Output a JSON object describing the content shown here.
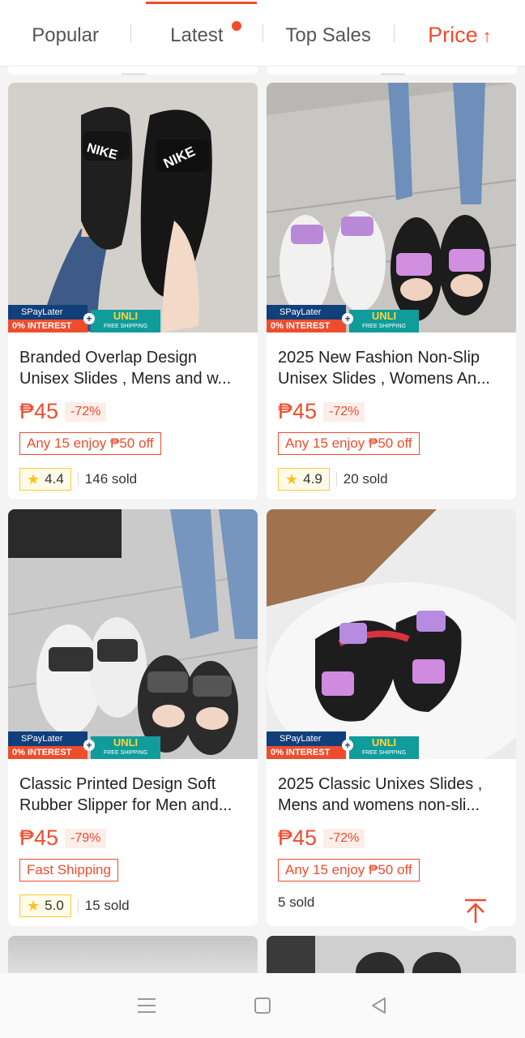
{
  "sort_tabs": [
    {
      "label": "Popular"
    },
    {
      "label": "Latest"
    },
    {
      "label": "Top Sales"
    },
    {
      "label": "Price",
      "arrow": "↑"
    }
  ],
  "badge": {
    "spay": "SPayLater",
    "interest": "0% INTEREST",
    "unli": "UNLI",
    "shipping": "FREE SHIPPING"
  },
  "products": [
    {
      "title_line1": "Branded Overlap Design",
      "title_line2": "Unisex Slides , Mens and w...",
      "price": "₱45",
      "discount": "-72%",
      "promo": "Any 15 enjoy ₱50 off",
      "rating": "4.4",
      "sold": "146 sold"
    },
    {
      "title_line1": "2025 New Fashion Non-Slip",
      "title_line2": "Unisex Slides , Womens An...",
      "price": "₱45",
      "discount": "-72%",
      "promo": "Any 15 enjoy ₱50 off",
      "rating": "4.9",
      "sold": "20 sold"
    },
    {
      "title_line1": "Classic Printed Design Soft",
      "title_line2": "Rubber Slipper for Men and...",
      "price": "₱45",
      "discount": "-79%",
      "promo": "Fast Shipping",
      "rating": "5.0",
      "sold": "15 sold"
    },
    {
      "title_line1": "2025 Classic Unixes Slides ,",
      "title_line2": "Mens and womens non-sli...",
      "price": "₱45",
      "discount": "-72%",
      "promo": "Any 15 enjoy ₱50 off",
      "rating": "",
      "sold": "5 sold"
    }
  ],
  "colors": {
    "accent": "#ee4d2d",
    "rating_star": "#ffbf1f"
  },
  "icons": {
    "back_to_top": "arrow-up-to-line-icon",
    "nav_menu": "menu-icon",
    "nav_home": "square-icon",
    "nav_back": "triangle-back-icon"
  }
}
